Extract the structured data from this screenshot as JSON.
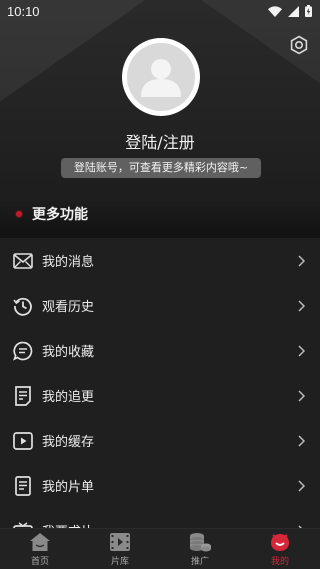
{
  "status_bar": {
    "time": "10:10"
  },
  "profile": {
    "login_text": "登陆/注册",
    "hint_text": "登陆账号，可查看更多精彩内容哦~"
  },
  "section": {
    "title": "更多功能"
  },
  "menu": [
    {
      "label": "我的消息",
      "icon": "mail-icon"
    },
    {
      "label": "观看历史",
      "icon": "history-icon"
    },
    {
      "label": "我的收藏",
      "icon": "chat-bubble-icon"
    },
    {
      "label": "我的追更",
      "icon": "document-list-icon"
    },
    {
      "label": "我的缓存",
      "icon": "play-square-icon"
    },
    {
      "label": "我的片单",
      "icon": "document-icon"
    },
    {
      "label": "我要求片",
      "icon": "tv-icon"
    }
  ],
  "bottom_nav": [
    {
      "label": "首页",
      "icon": "home-icon"
    },
    {
      "label": "片库",
      "icon": "film-icon"
    },
    {
      "label": "推广",
      "icon": "coins-icon"
    },
    {
      "label": "我的",
      "icon": "user-smile-icon",
      "active": true
    }
  ],
  "colors": {
    "accent": "#d6263a",
    "background": "#1f1f1f"
  }
}
